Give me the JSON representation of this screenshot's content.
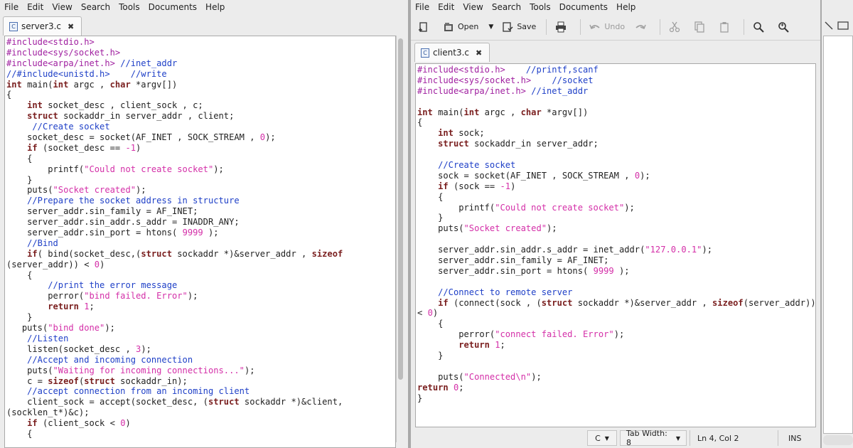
{
  "left_window": {
    "menu": [
      "File",
      "Edit",
      "View",
      "Search",
      "Tools",
      "Documents",
      "Help"
    ],
    "tab": {
      "title": "server3.c",
      "file_icon": "C",
      "close_glyph": "✖"
    },
    "code": [
      [
        [
          "pp",
          "#include<stdio.h>"
        ]
      ],
      [
        [
          "pp",
          "#include<sys/socket.h>"
        ]
      ],
      [
        [
          "pp",
          "#include<arpa/inet.h> "
        ],
        [
          "cm",
          "//inet_addr"
        ]
      ],
      [
        [
          "cm",
          "//#include<unistd.h>    //write"
        ]
      ],
      [
        [
          "kw",
          "int"
        ],
        [
          "t",
          " main("
        ],
        [
          "kw",
          "int"
        ],
        [
          "t",
          " argc , "
        ],
        [
          "kw",
          "char"
        ],
        [
          "t",
          " *argv[])"
        ]
      ],
      [
        [
          "t",
          "{"
        ]
      ],
      [
        [
          "t",
          "    "
        ],
        [
          "kw",
          "int"
        ],
        [
          "t",
          " socket_desc , client_sock , c;"
        ]
      ],
      [
        [
          "t",
          "    "
        ],
        [
          "kw",
          "struct"
        ],
        [
          "t",
          " sockaddr_in server_addr , client;"
        ]
      ],
      [
        [
          "t",
          "     "
        ],
        [
          "cm",
          "//Create socket"
        ]
      ],
      [
        [
          "t",
          "    socket_desc = socket(AF_INET , SOCK_STREAM , "
        ],
        [
          "num",
          "0"
        ],
        [
          "t",
          ");"
        ]
      ],
      [
        [
          "t",
          "    "
        ],
        [
          "kw",
          "if"
        ],
        [
          "t",
          " (socket_desc == "
        ],
        [
          "num",
          "-1"
        ],
        [
          "t",
          ")"
        ]
      ],
      [
        [
          "t",
          "    {"
        ]
      ],
      [
        [
          "t",
          "        printf("
        ],
        [
          "str",
          "\"Could not create socket\""
        ],
        [
          "t",
          ");"
        ]
      ],
      [
        [
          "t",
          "    }"
        ]
      ],
      [
        [
          "t",
          "    puts("
        ],
        [
          "str",
          "\"Socket created\""
        ],
        [
          "t",
          ");"
        ]
      ],
      [
        [
          "t",
          "    "
        ],
        [
          "cm",
          "//Prepare the socket address in structure"
        ]
      ],
      [
        [
          "t",
          "    server_addr.sin_family = AF_INET;"
        ]
      ],
      [
        [
          "t",
          "    server_addr.sin_addr.s_addr = INADDR_ANY;"
        ]
      ],
      [
        [
          "t",
          "    server_addr.sin_port = htons( "
        ],
        [
          "num",
          "9999"
        ],
        [
          "t",
          " );"
        ]
      ],
      [
        [
          "t",
          "    "
        ],
        [
          "cm",
          "//Bind"
        ]
      ],
      [
        [
          "t",
          "    "
        ],
        [
          "kw",
          "if"
        ],
        [
          "t",
          "( bind(socket_desc,("
        ],
        [
          "kw",
          "struct"
        ],
        [
          "t",
          " sockaddr *)&server_addr , "
        ],
        [
          "kw",
          "sizeof"
        ]
      ],
      [
        [
          "t",
          "(server_addr)) < "
        ],
        [
          "num",
          "0"
        ],
        [
          "t",
          ")"
        ]
      ],
      [
        [
          "t",
          "    {"
        ]
      ],
      [
        [
          "t",
          "        "
        ],
        [
          "cm",
          "//print the error message"
        ]
      ],
      [
        [
          "t",
          "        perror("
        ],
        [
          "str",
          "\"bind failed. Error\""
        ],
        [
          "t",
          ");"
        ]
      ],
      [
        [
          "t",
          "        "
        ],
        [
          "kw",
          "return"
        ],
        [
          "t",
          " "
        ],
        [
          "num",
          "1"
        ],
        [
          "t",
          ";"
        ]
      ],
      [
        [
          "t",
          "    }"
        ]
      ],
      [
        [
          "t",
          "   puts("
        ],
        [
          "str",
          "\"bind done\""
        ],
        [
          "t",
          ");"
        ]
      ],
      [
        [
          "t",
          "    "
        ],
        [
          "cm",
          "//Listen"
        ]
      ],
      [
        [
          "t",
          "    listen(socket_desc , "
        ],
        [
          "num",
          "3"
        ],
        [
          "t",
          ");"
        ]
      ],
      [
        [
          "t",
          "    "
        ],
        [
          "cm",
          "//Accept and incoming connection"
        ]
      ],
      [
        [
          "t",
          "    puts("
        ],
        [
          "str",
          "\"Waiting for incoming connections...\""
        ],
        [
          "t",
          ");"
        ]
      ],
      [
        [
          "t",
          "    c = "
        ],
        [
          "kw",
          "sizeof"
        ],
        [
          "t",
          "("
        ],
        [
          "kw",
          "struct"
        ],
        [
          "t",
          " sockaddr_in);"
        ]
      ],
      [
        [
          "t",
          "    "
        ],
        [
          "cm",
          "//accept connection from an incoming client"
        ]
      ],
      [
        [
          "t",
          "    client_sock = accept(socket_desc, ("
        ],
        [
          "kw",
          "struct"
        ],
        [
          "t",
          " sockaddr *)&client,"
        ]
      ],
      [
        [
          "t",
          "(socklen_t*)&c);"
        ]
      ],
      [
        [
          "t",
          "    "
        ],
        [
          "kw",
          "if"
        ],
        [
          "t",
          " (client_sock < "
        ],
        [
          "num",
          "0"
        ],
        [
          "t",
          ")"
        ]
      ],
      [
        [
          "t",
          "    {"
        ]
      ]
    ]
  },
  "right_window": {
    "menu": [
      "File",
      "Edit",
      "View",
      "Search",
      "Tools",
      "Documents",
      "Help"
    ],
    "toolbar": {
      "open_label": "Open",
      "save_label": "Save",
      "undo_label": "Undo",
      "dropdown_glyph": "▼"
    },
    "tab": {
      "title": "client3.c",
      "file_icon": "C",
      "close_glyph": "✖"
    },
    "code": [
      [
        [
          "pp",
          "#include<stdio.h>    "
        ],
        [
          "cm",
          "//printf,scanf"
        ]
      ],
      [
        [
          "pp",
          "#include<sys/socket.h>    "
        ],
        [
          "cm",
          "//socket"
        ]
      ],
      [
        [
          "pp",
          "#include<arpa/inet.h> "
        ],
        [
          "cm",
          "//inet_addr"
        ]
      ],
      [
        [
          "t",
          ""
        ]
      ],
      [
        [
          "kw",
          "int"
        ],
        [
          "t",
          " main("
        ],
        [
          "kw",
          "int"
        ],
        [
          "t",
          " argc , "
        ],
        [
          "kw",
          "char"
        ],
        [
          "t",
          " *argv[])"
        ]
      ],
      [
        [
          "t",
          "{"
        ]
      ],
      [
        [
          "t",
          "    "
        ],
        [
          "kw",
          "int"
        ],
        [
          "t",
          " sock;"
        ]
      ],
      [
        [
          "t",
          "    "
        ],
        [
          "kw",
          "struct"
        ],
        [
          "t",
          " sockaddr_in server_addr;"
        ]
      ],
      [
        [
          "t",
          ""
        ]
      ],
      [
        [
          "t",
          "    "
        ],
        [
          "cm",
          "//Create socket"
        ]
      ],
      [
        [
          "t",
          "    sock = socket(AF_INET , SOCK_STREAM , "
        ],
        [
          "num",
          "0"
        ],
        [
          "t",
          ");"
        ]
      ],
      [
        [
          "t",
          "    "
        ],
        [
          "kw",
          "if"
        ],
        [
          "t",
          " (sock == "
        ],
        [
          "num",
          "-1"
        ],
        [
          "t",
          ")"
        ]
      ],
      [
        [
          "t",
          "    {"
        ]
      ],
      [
        [
          "t",
          "        printf("
        ],
        [
          "str",
          "\"Could not create socket\""
        ],
        [
          "t",
          ");"
        ]
      ],
      [
        [
          "t",
          "    }"
        ]
      ],
      [
        [
          "t",
          "    puts("
        ],
        [
          "str",
          "\"Socket created\""
        ],
        [
          "t",
          ");"
        ]
      ],
      [
        [
          "t",
          ""
        ]
      ],
      [
        [
          "t",
          "    server_addr.sin_addr.s_addr = inet_addr("
        ],
        [
          "str",
          "\"127.0.0.1\""
        ],
        [
          "t",
          ");"
        ]
      ],
      [
        [
          "t",
          "    server_addr.sin_family = AF_INET;"
        ]
      ],
      [
        [
          "t",
          "    server_addr.sin_port = htons( "
        ],
        [
          "num",
          "9999"
        ],
        [
          "t",
          " );"
        ]
      ],
      [
        [
          "t",
          ""
        ]
      ],
      [
        [
          "t",
          "    "
        ],
        [
          "cm",
          "//Connect to remote server"
        ]
      ],
      [
        [
          "t",
          "    "
        ],
        [
          "kw",
          "if"
        ],
        [
          "t",
          " (connect(sock , ("
        ],
        [
          "kw",
          "struct"
        ],
        [
          "t",
          " sockaddr *)&server_addr , "
        ],
        [
          "kw",
          "sizeof"
        ],
        [
          "t",
          "(server_addr))"
        ]
      ],
      [
        [
          "t",
          "< "
        ],
        [
          "num",
          "0"
        ],
        [
          "t",
          ")"
        ]
      ],
      [
        [
          "t",
          "    {"
        ]
      ],
      [
        [
          "t",
          "        perror("
        ],
        [
          "str",
          "\"connect failed. Error\""
        ],
        [
          "t",
          ");"
        ]
      ],
      [
        [
          "t",
          "        "
        ],
        [
          "kw",
          "return"
        ],
        [
          "t",
          " "
        ],
        [
          "num",
          "1"
        ],
        [
          "t",
          ";"
        ]
      ],
      [
        [
          "t",
          "    }"
        ]
      ],
      [
        [
          "t",
          ""
        ]
      ],
      [
        [
          "t",
          "    puts("
        ],
        [
          "str",
          "\"Connected\\n\""
        ],
        [
          "t",
          ");"
        ]
      ],
      [
        [
          "kw",
          "return"
        ],
        [
          "t",
          " "
        ],
        [
          "num",
          "0"
        ],
        [
          "t",
          ";"
        ]
      ],
      [
        [
          "t",
          "}"
        ]
      ]
    ],
    "statusbar": {
      "language": "C",
      "language_glyph": "▼",
      "tab_width": "Tab Width:  8",
      "tab_width_glyph": "▼",
      "cursor_position": "Ln 4, Col 2",
      "insert_mode": "INS"
    }
  },
  "colors": {
    "keyword": "#7a1f1f",
    "preprocessor": "#a020a0",
    "string": "#d42fa8",
    "comment": "#1e3fc7"
  }
}
